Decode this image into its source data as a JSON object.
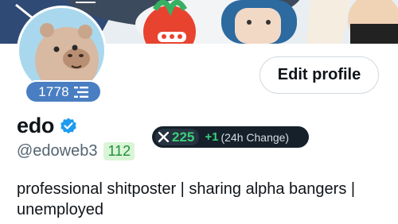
{
  "profile": {
    "display_name": "edo",
    "handle": "@edoweb3",
    "handle_count": "112",
    "bio": "professional shitposter | sharing alpha bangers | unemployed",
    "level": "1778",
    "edit_button_label": "Edit profile"
  },
  "score": {
    "value": "225",
    "change": "+1",
    "change_label": "(24h Change)"
  },
  "colors": {
    "banner": "#3d5f86",
    "avatar_bg": "#a9d8ee",
    "level_badge": "#4a7ec2",
    "verified": "#1d9bf0",
    "score_pill": "#15202b",
    "score_green": "#3ad17a",
    "handle_count_bg": "#d9f5d6",
    "handle_count_text": "#1f8f3a"
  },
  "icons": {
    "level": "stacked-lines-icon",
    "verified": "verified-badge-icon",
    "score": "x-logo-icon"
  }
}
